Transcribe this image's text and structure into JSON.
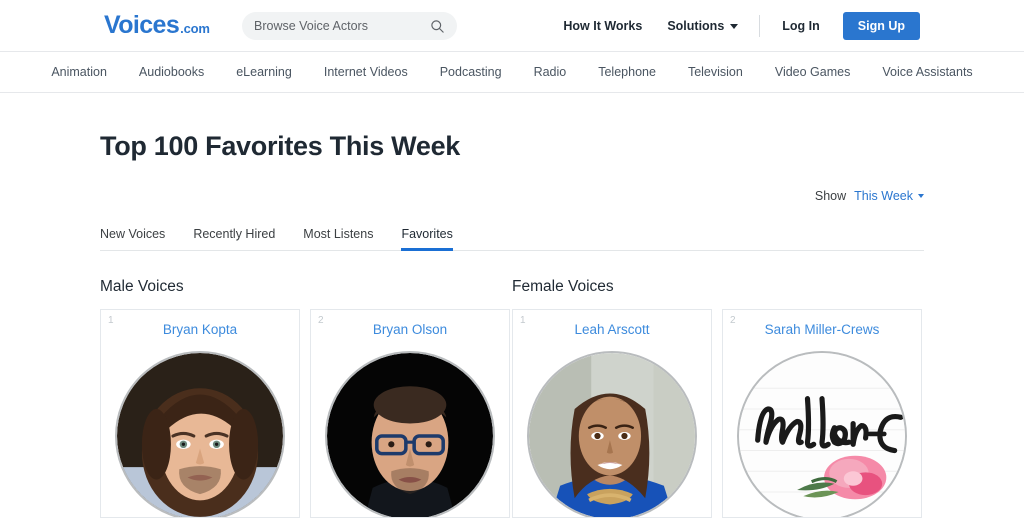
{
  "header": {
    "logo_main": "Voices",
    "logo_tld": ".com",
    "search_placeholder": "Browse Voice Actors",
    "search_value": "",
    "search_icon": "search-icon",
    "nav": {
      "how_it_works": "How It Works",
      "solutions": "Solutions",
      "log_in": "Log In",
      "sign_up": "Sign Up"
    }
  },
  "category_nav": {
    "items": [
      {
        "label": "Animation"
      },
      {
        "label": "Audiobooks"
      },
      {
        "label": "eLearning"
      },
      {
        "label": "Internet Videos"
      },
      {
        "label": "Podcasting"
      },
      {
        "label": "Radio"
      },
      {
        "label": "Telephone"
      },
      {
        "label": "Television"
      },
      {
        "label": "Video Games"
      },
      {
        "label": "Voice Assistants"
      }
    ]
  },
  "main": {
    "page_title": "Top 100 Favorites This Week",
    "show_label": "Show",
    "show_value": "This Week",
    "tabs": [
      {
        "label": "New Voices",
        "active": false
      },
      {
        "label": "Recently Hired",
        "active": false
      },
      {
        "label": "Most Listens",
        "active": false
      },
      {
        "label": "Favorites",
        "active": true
      }
    ],
    "columns": [
      {
        "heading": "Male Voices",
        "cards": [
          {
            "rank": "1",
            "name": "Bryan Kopta"
          },
          {
            "rank": "2",
            "name": "Bryan Olson"
          }
        ]
      },
      {
        "heading": "Female Voices",
        "cards": [
          {
            "rank": "1",
            "name": "Leah Arscott"
          },
          {
            "rank": "2",
            "name": "Sarah Miller-Crews"
          }
        ]
      }
    ]
  },
  "colors": {
    "brand_blue": "#2a76cf",
    "link_blue": "#3d8bdd",
    "tab_underline": "#1a6fd4",
    "text_dark": "#1f2933",
    "text_muted": "#4a5561",
    "border": "#e4e8ec",
    "search_bg": "#f1f3f4"
  }
}
